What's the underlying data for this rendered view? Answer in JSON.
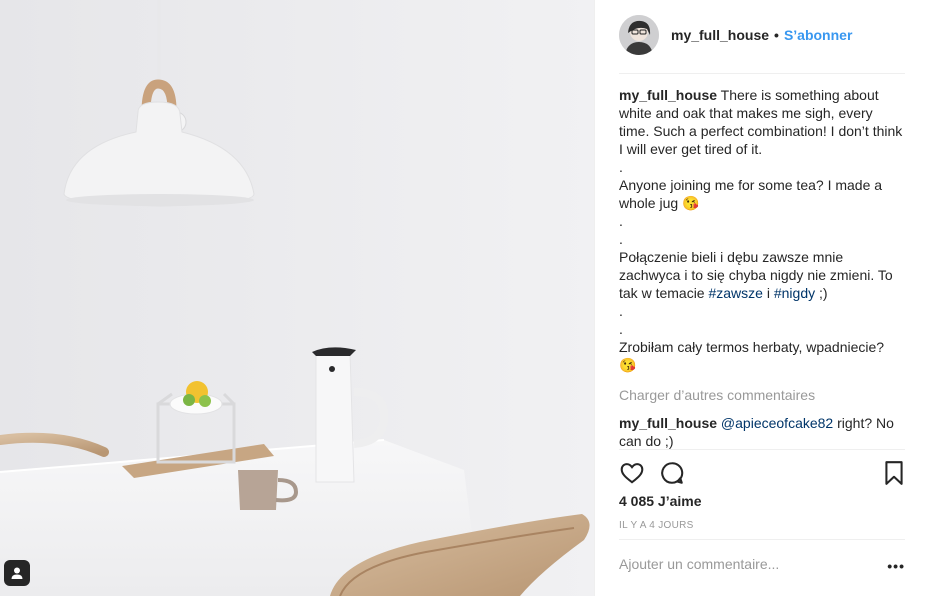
{
  "header": {
    "username": "my_full_house",
    "separator": "•",
    "follow_label": "S’abonner"
  },
  "caption": {
    "username": "my_full_house",
    "text_part1": " There is something about white and oak that makes me sigh, every time. Such a perfect combination! I don’t think I will ever get tired of it.\n.\nAnyone joining me for some tea? I made a whole jug 😘\n.\n.\nPołączenie bieli i dębu zawsze mnie zachwyca i to się chyba nigdy nie zmieni. To tak w temacie ",
    "hashtag1": "#zawsze",
    "text_part2": " i ",
    "hashtag2": "#nigdy",
    "text_part3": " ;)\n.\n.\nZrobiłam cały termos herbaty, wpadniecie? 😘"
  },
  "load_more_label": "Charger d’autres commentaires",
  "comment": {
    "username": "my_full_house",
    "mention": "@apieceofcake82",
    "text": " right? No can do ;)"
  },
  "actions": {
    "like_icon": "heart-icon",
    "comment_icon": "comment-bubble-icon",
    "save_icon": "bookmark-icon"
  },
  "likes_label": "4 085 J’aime",
  "timestamp": "Il y a 4 jours",
  "add_comment_placeholder": "Ajouter un commentaire...",
  "more_label": "•••",
  "colors": {
    "link_blue": "#3897f0",
    "hashtag_blue": "#003569",
    "muted_gray": "#999999",
    "text": "#262626"
  }
}
